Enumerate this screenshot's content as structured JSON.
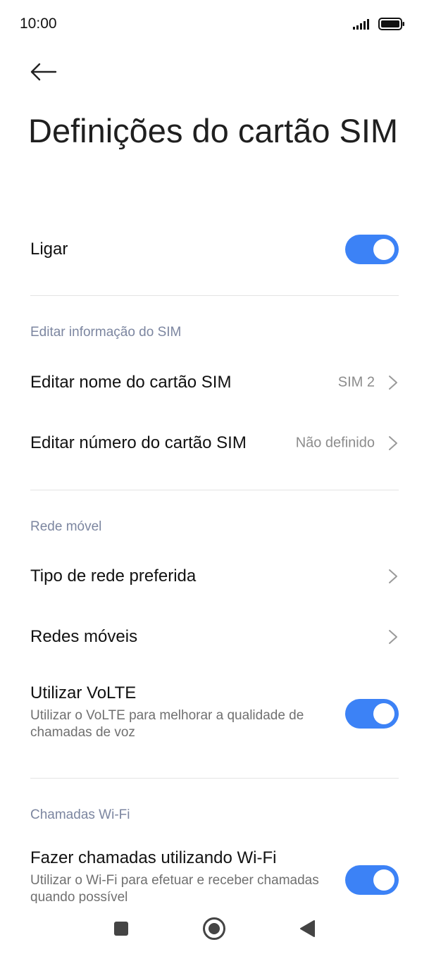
{
  "status_bar": {
    "time": "10:00",
    "signal_icon": "signal-bars-icon",
    "battery_icon": "battery-icon"
  },
  "header": {
    "back_icon": "arrow-left-icon",
    "title": "Definições do cartão SIM"
  },
  "main": {
    "power": {
      "label": "Ligar",
      "enabled": true
    },
    "sim_info_section": {
      "header": "Editar informação do SIM",
      "items": [
        {
          "label": "Editar nome do cartão SIM",
          "value": "SIM 2"
        },
        {
          "label": "Editar número do cartão SIM",
          "value": "Não definido"
        }
      ]
    },
    "mobile_network_section": {
      "header": "Rede móvel",
      "items": [
        {
          "label": "Tipo de rede preferida"
        },
        {
          "label": "Redes móveis"
        }
      ],
      "volte": {
        "label": "Utilizar VoLTE",
        "description": "Utilizar o VoLTE para melhorar a qualidade de chamadas de voz",
        "enabled": true
      }
    },
    "wifi_calling_section": {
      "header": "Chamadas Wi-Fi",
      "wifi_calling": {
        "label": "Fazer chamadas utilizando Wi-Fi",
        "description": "Utilizar o Wi-Fi para efetuar e receber chamadas quando possível",
        "enabled": true
      }
    }
  },
  "nav_bar": {
    "recents_icon": "square-icon",
    "home_icon": "circle-home-icon",
    "back_icon": "triangle-back-icon"
  },
  "colors": {
    "accent": "#3c82f6",
    "section_header": "#7c86a0",
    "secondary_text": "#8c8c8c"
  }
}
